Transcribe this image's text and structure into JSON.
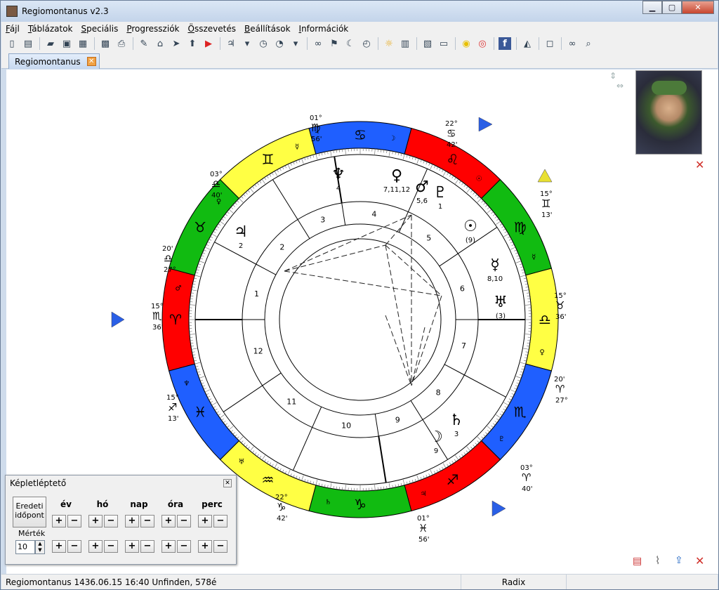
{
  "window": {
    "title": "Regiomontanus v2.3"
  },
  "menu": [
    "Fájl",
    "Táblázatok",
    "Speciális",
    "Progressziók",
    "Összevetés",
    "Beállítások",
    "Információk"
  ],
  "toolbar_icons": [
    "new-chart-icon",
    "new-document-icon",
    "open-folder-icon",
    "save-icon",
    "save-as-icon",
    "picture-icon",
    "print-icon",
    "pen-icon",
    "home-icon",
    "cursor-icon",
    "up-arrow-icon",
    "flag-icon",
    "planet-selector-icon",
    "dropdown-icon",
    "clock-icon",
    "dial-icon",
    "dropdown-icon",
    "linked-circles-icon",
    "signpost-icon",
    "moon-icon",
    "timer-icon",
    "sun-icon",
    "book-icon",
    "books-icon",
    "monitor-icon",
    "lightbulb-icon",
    "help-ring-icon",
    "facebook-icon",
    "graduation-cap-icon",
    "speech-bubble-icon",
    "glasses-icon",
    "magnifier-icon"
  ],
  "tab": {
    "label": "Regiomontanus"
  },
  "status": {
    "left": "Regiomontanus 1436.06.15 16:40 Unfinden,     578é",
    "mid": "Radix"
  },
  "stepper": {
    "title": "Képletléptető",
    "original_line1": "Eredeti",
    "original_line2": "időpont",
    "columns": [
      "év",
      "hó",
      "nap",
      "óra",
      "perc"
    ],
    "mertek_label": "Mérték",
    "mertek_value": "10",
    "plus": "+",
    "minus": "−"
  },
  "colors": {
    "red": "#ff0000",
    "blue": "#1f5fff",
    "yellow": "#ffff44",
    "green": "#11bb11",
    "house_line": "#000000"
  },
  "chart": {
    "signs": [
      {
        "glyph": "♑",
        "color": "green",
        "ruler": "♄"
      },
      {
        "glyph": "♒",
        "color": "yellow",
        "ruler": "♅"
      },
      {
        "glyph": "♓",
        "color": "blue",
        "ruler": "♆"
      },
      {
        "glyph": "♈",
        "color": "red",
        "ruler": "♂"
      },
      {
        "glyph": "♉",
        "color": "green",
        "ruler": "♀"
      },
      {
        "glyph": "♊",
        "color": "yellow",
        "ruler": "☿"
      },
      {
        "glyph": "♋",
        "color": "blue",
        "ruler": "☽"
      },
      {
        "glyph": "♌",
        "color": "red",
        "ruler": "☉"
      },
      {
        "glyph": "♍",
        "color": "green",
        "ruler": "☿"
      },
      {
        "glyph": "♎",
        "color": "yellow",
        "ruler": "♀"
      },
      {
        "glyph": "♏",
        "color": "blue",
        "ruler": "♇"
      },
      {
        "glyph": "♐",
        "color": "red",
        "ruler": "♃"
      }
    ],
    "house_numbers": [
      "1",
      "2",
      "3",
      "4",
      "5",
      "6",
      "7",
      "8",
      "9",
      "10",
      "11",
      "12"
    ],
    "cusp_labels": [
      {
        "deg": "15°",
        "glyph": "♏",
        "min": "36'"
      },
      {
        "deg": "15°",
        "glyph": "♐",
        "min": "13'"
      },
      {
        "deg": "22°",
        "glyph": "♑",
        "min": "42'"
      },
      {
        "deg": "01°",
        "glyph": "♓",
        "min": "56'"
      },
      {
        "deg": "03°",
        "glyph": "♈",
        "min": "40'"
      },
      {
        "deg": "20'",
        "glyph": "♈",
        "min": "27°"
      },
      {
        "deg": "15°",
        "glyph": "♉",
        "min": "36'"
      },
      {
        "deg": "15°",
        "glyph": "♊",
        "min": "13'"
      },
      {
        "deg": "22°",
        "glyph": "♋",
        "min": "42'"
      },
      {
        "deg": "01°",
        "glyph": "♍",
        "min": "56'"
      },
      {
        "deg": "03°",
        "glyph": "♎",
        "min": "40'"
      },
      {
        "deg": "20'",
        "glyph": "♎",
        "min": "27°"
      }
    ],
    "planets": [
      {
        "glyph": "♆",
        "label": "4"
      },
      {
        "glyph": "♀",
        "label": "7,11,12"
      },
      {
        "glyph": "♂",
        "label": "5,6"
      },
      {
        "glyph": "♇",
        "label": "1"
      },
      {
        "glyph": "☉",
        "label": "(9)"
      },
      {
        "glyph": "☿",
        "label": "8,10"
      },
      {
        "glyph": "♅",
        "label": "(3)"
      },
      {
        "glyph": "♄",
        "label": "3"
      },
      {
        "glyph": "☽",
        "label": "9"
      },
      {
        "glyph": "♃",
        "label": "2"
      }
    ]
  }
}
